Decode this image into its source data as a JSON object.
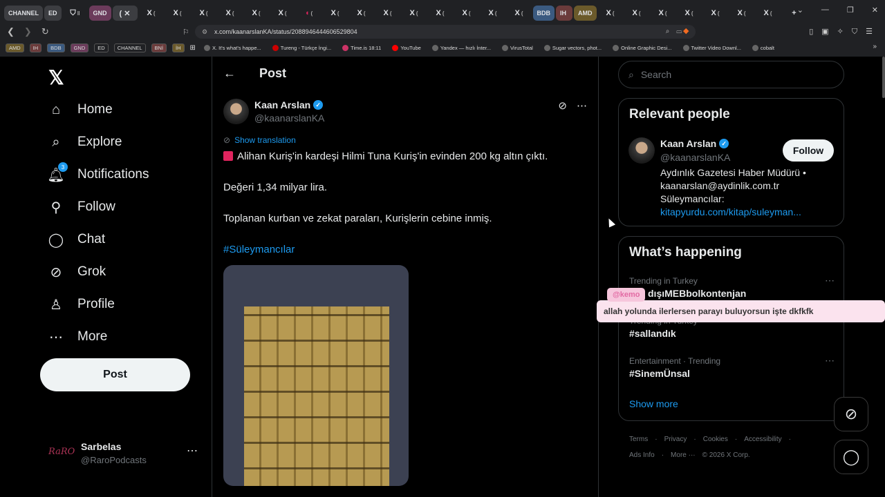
{
  "browser": {
    "tabs": [
      "CHANNEL",
      "ED",
      "",
      "GND",
      "",
      "",
      "",
      "",
      "",
      "",
      "",
      "",
      "",
      "",
      "",
      "",
      "",
      "",
      "",
      "",
      "",
      "BDB",
      "IH",
      "AMD",
      "",
      "",
      "",
      "",
      "",
      "",
      "",
      ""
    ],
    "url": "x.com/kaanarslanKA/status/2088946444606529804",
    "bookmarks": [
      "AMD",
      "IH",
      "BDB",
      "GND",
      "ED",
      "CHANNEL",
      "BNİ",
      "İH"
    ],
    "bookmark_links": [
      "X. It's what's happe...",
      "Tureng - Türkçe İngi...",
      "Time.is 18:11",
      "YouTube",
      "Yandex — hızlı İnter...",
      "VirusTotal",
      "Sugar vectors, phot...",
      "Online Graphic Desi...",
      "Twitter Video Downl...",
      "cobalt"
    ]
  },
  "nav": {
    "items": [
      {
        "label": "Home",
        "icon": "home-icon"
      },
      {
        "label": "Explore",
        "icon": "search-icon"
      },
      {
        "label": "Notifications",
        "icon": "bell-icon",
        "badge": "3"
      },
      {
        "label": "Follow",
        "icon": "follow-icon"
      },
      {
        "label": "Chat",
        "icon": "chat-icon"
      },
      {
        "label": "Grok",
        "icon": "grok-icon"
      },
      {
        "label": "Profile",
        "icon": "person-icon"
      },
      {
        "label": "More",
        "icon": "more-icon"
      }
    ],
    "post_label": "Post",
    "account": {
      "avatar": "RaRO",
      "name": "Sarbelas",
      "handle": "@RaroPodcasts"
    }
  },
  "post": {
    "header": "Post",
    "author_name": "Kaan Arslan",
    "author_handle": "@kaanarslanKA",
    "show_translation": "Show translation",
    "line1": "Alihan Kuriş'in kardeşi Hilmi Tuna Kuriş'in evinden 200 kg altın çıktı.",
    "line2": "Değeri 1,34 milyar lira.",
    "line3": "Toplanan kurban ve zekat paraları, Kurişlerin cebine inmiş.",
    "hashtag": "#Süleymancılar"
  },
  "right": {
    "search_placeholder": "Search",
    "relevant_title": "Relevant people",
    "person": {
      "name": "Kaan Arslan",
      "handle": "@kaanarslanKA",
      "follow_label": "Follow",
      "bio1": "Aydınlık Gazetesi Haber Müdürü •",
      "bio2": "kaanarslan@aydinlik.com.tr",
      "bio3": "Süleymancılar:",
      "bio_link": "kitapyurdu.com/kitap/suleyman..."
    },
    "happening_title": "What’s happening",
    "trends": [
      {
        "meta": "Trending in Turkey",
        "name": "dışıMEBbolkontenjan"
      },
      {
        "meta": "Trending in Turkey",
        "name": "#sallandık"
      },
      {
        "meta": "Entertainment · Trending",
        "name": "#SinemÜnsal"
      }
    ],
    "show_more": "Show more",
    "footer1": [
      "Terms",
      "·",
      "Privacy",
      "·",
      "Cookies",
      "·",
      "Accessibility",
      "·"
    ],
    "footer2": [
      "Ads Info",
      "·",
      "More ···",
      "© 2026 X Corp."
    ]
  },
  "overlay": {
    "tag": "@kemo",
    "message": "allah yolunda ilerlersen parayı buluyorsun işte dkfkfk"
  }
}
